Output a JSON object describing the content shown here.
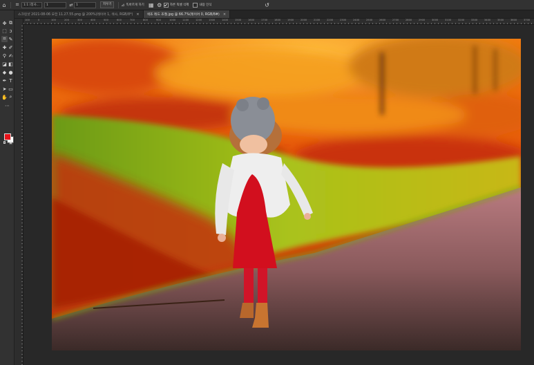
{
  "options_bar": {
    "ratio_value": "1:1 (정사...",
    "width_value": "1",
    "height_value": "1",
    "clear_label": "지우기",
    "straighten_label": "똑바르게 하기",
    "delete_cropped_label": "자른 픽셀 삭제",
    "delete_cropped_checked": true,
    "content_aware_label": "내용 인식",
    "content_aware_checked": false
  },
  "tabs": [
    {
      "label": "스크린샷 2021-08-06 오전 11.27.55.png @ 200%(레이어 1, 색사, RGB/8*)",
      "active": false
    },
    {
      "label": "색조 레드 조절.jpg @ 66.7%(레이어 0, RGB/8#)",
      "active": true
    }
  ],
  "ruler_ticks": [
    "100",
    "0",
    "100",
    "200",
    "300",
    "400",
    "500",
    "600",
    "700",
    "800",
    "900",
    "1000",
    "1100",
    "1200",
    "1300",
    "1400",
    "1500",
    "1600",
    "1700",
    "1800",
    "1900",
    "2000",
    "2100",
    "2200",
    "2300",
    "2400",
    "2500",
    "2600",
    "2700",
    "2800",
    "2900",
    "3000",
    "3100",
    "3200",
    "3300",
    "3400",
    "3500",
    "3600",
    "3700"
  ],
  "colors": {
    "foreground": "#e8131a",
    "background": "#ffffff",
    "ui_panel": "#323232",
    "pasteboard": "#282828"
  },
  "tools": [
    "move-tool",
    "artboard-tool",
    "marquee-tool",
    "lasso-tool",
    "crop-tool",
    "frame-tool",
    "eyedropper-tool",
    "spot-healing-tool",
    "brush-tool",
    "stamp-tool",
    "history-brush-tool",
    "eraser-tool",
    "gradient-tool",
    "blur-tool",
    "dodge-tool",
    "pen-tool",
    "type-tool",
    "path-selection-tool",
    "shape-tool",
    "hand-tool",
    "zoom-tool",
    "edit-toolbar"
  ]
}
